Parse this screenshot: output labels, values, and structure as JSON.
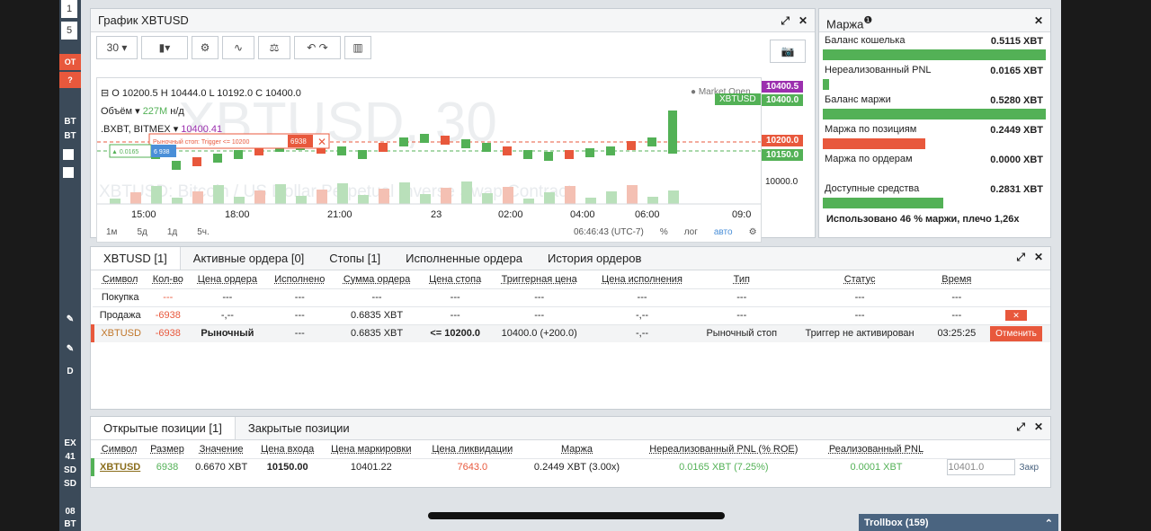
{
  "sidebar": {
    "items": [
      "1",
      "5",
      "OT",
      "?",
      "BT",
      "BT",
      "EX",
      "41",
      "SD",
      "SD",
      "D",
      "BT",
      "08"
    ]
  },
  "chart_panel": {
    "title": "График XBTUSD",
    "interval": "30",
    "ohlc": "O 10200.5 H 10444.0 L 10192.0 C 10400.0",
    "volume_label": "Объём",
    "volume_value": "227M",
    "volume_unit": "н/д",
    "index_label": ".BXBT, BITMEX",
    "index_value": "10400.41",
    "watermark": "XBTUSD, 30",
    "subtitle": "XBTUSD: Bitcoin / US Dollar Perpetual Inverse Swap Contract",
    "market_open": "Market Open",
    "stop_label": "Рыночный стоп: Trigger <= 10200",
    "stop_qty": "6938",
    "pos_label": "▲ 0.0165",
    "pos_qty": "6 938",
    "price_tags": [
      "10400.5",
      "10400.0",
      "10200.0",
      "10150.0",
      "10000.0"
    ],
    "symbol_tag": "XBTUSD",
    "times": [
      "15:00",
      "18:00",
      "21:00",
      "23",
      "02:00",
      "04:00",
      "06:00",
      "09:0"
    ],
    "ranges": [
      "1м",
      "5д",
      "1д",
      "5ч."
    ],
    "clock": "06:46:43 (UTC-7)",
    "pct": "%",
    "log": "лог",
    "auto": "авто"
  },
  "margin": {
    "title": "Маржа",
    "rows": [
      {
        "label": "Баланс кошелька",
        "value": "0.5115 XBT",
        "fill": 1.0,
        "color": "#53b156"
      },
      {
        "label": "Нереализованный PNL",
        "value": "0.0165 XBT",
        "fill": 0.03,
        "color": "#53b156"
      },
      {
        "label": "Баланс маржи",
        "value": "0.5280 XBT",
        "fill": 1.0,
        "color": "#53b156"
      },
      {
        "label": "Маржа по позициям",
        "value": "0.2449 XBT",
        "fill": 0.46,
        "color": "#e8583c"
      },
      {
        "label": "Маржа по ордерам",
        "value": "0.0000 XBT",
        "fill": 0.0,
        "color": "#e8583c"
      },
      {
        "label": "Доступные средства",
        "value": "0.2831 XBT",
        "fill": 0.54,
        "color": "#53b156"
      }
    ],
    "footer": "Использовано 46 % маржи, плечо 1,26x"
  },
  "orders": {
    "tabs": [
      "XBTUSD [1]",
      "Активные ордера [0]",
      "Стопы [1]",
      "Исполненные ордера",
      "История ордеров"
    ],
    "headers": [
      "Символ",
      "Кол-во",
      "Цена ордера",
      "Исполнено",
      "Сумма ордера",
      "Цена стопа",
      "Триггерная цена",
      "Цена исполнения",
      "Тип",
      "Статус",
      "Время"
    ],
    "rows": [
      [
        "Покупка",
        "---",
        "---",
        "---",
        "---",
        "---",
        "---",
        "---",
        "---",
        "---",
        "---"
      ],
      [
        "Продажа",
        "-6938",
        "-,--",
        "---",
        "0.6835 XBT",
        "---",
        "---",
        "-,--",
        "---",
        "---",
        "---"
      ],
      [
        "XBTUSD",
        "-6938",
        "Рыночный",
        "---",
        "0.6835 XBT",
        "<= 10200.0",
        "10400.0 (+200.0)",
        "-,--",
        "Рыночный стоп",
        "Триггер не активирован",
        "03:25:25"
      ]
    ],
    "cancel_label": "Отменить"
  },
  "positions": {
    "tabs": [
      "Открытые позиции [1]",
      "Закрытые позиции"
    ],
    "headers": [
      "Символ",
      "Размер",
      "Значение",
      "Цена входа",
      "Цена маркировки",
      "Цена ликвидации",
      "Маржа",
      "Нереализованный PNL (% ROE)",
      "Реализованный PNL"
    ],
    "row": [
      "XBTUSD",
      "6938",
      "0.6670 XBT",
      "10150.00",
      "10401.22",
      "7643.0",
      "0.2449 XBT (3.00x)",
      "0.0165 XBT (7.25%)",
      "0.0001 XBT"
    ],
    "close_input": "10401.0",
    "close_btn": "Закр"
  },
  "trollbox": "Trollbox (159)"
}
